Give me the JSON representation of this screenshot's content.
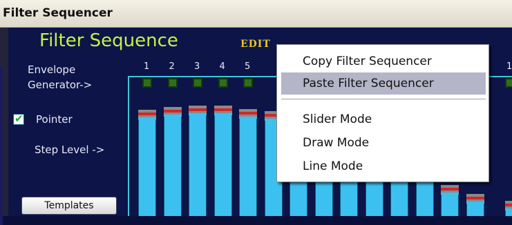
{
  "window": {
    "title": "Filter Sequencer"
  },
  "panel": {
    "heading": "Filter Sequence",
    "edit_label": "EDIT",
    "envelope_label_line1": "Envelope",
    "envelope_label_line2": "Generator->",
    "pointer_label": "Pointer",
    "pointer_checked": true,
    "step_level_label": "Step Level ->",
    "templates_button": "Templates"
  },
  "steps": {
    "numbers": [
      "1",
      "2",
      "3",
      "4",
      "5"
    ],
    "partial_right_number": "1"
  },
  "step_levels": [
    0.96,
    0.99,
    1.0,
    1.0,
    0.97,
    0.95,
    0.92,
    0.88,
    0.82,
    0.75,
    0.62,
    0.5,
    0.28,
    0.2,
    0.14
  ],
  "context_menu": {
    "items": [
      {
        "label": "Copy Filter Sequencer",
        "highlighted": false
      },
      {
        "label": "Paste  Filter Sequencer",
        "highlighted": true
      },
      {
        "label": "Slider Mode",
        "highlighted": false
      },
      {
        "label": "Draw Mode",
        "highlighted": false
      },
      {
        "label": "Line Mode",
        "highlighted": false
      }
    ]
  },
  "colors": {
    "panel_bg": "#0c1448",
    "heading": "#c8f048",
    "edit": "#e8c820",
    "bar": "#3cc0f0",
    "grid_line": "#3fc8d8",
    "led": "#2f6e1a",
    "menu_highlight": "#b5b5c8"
  }
}
